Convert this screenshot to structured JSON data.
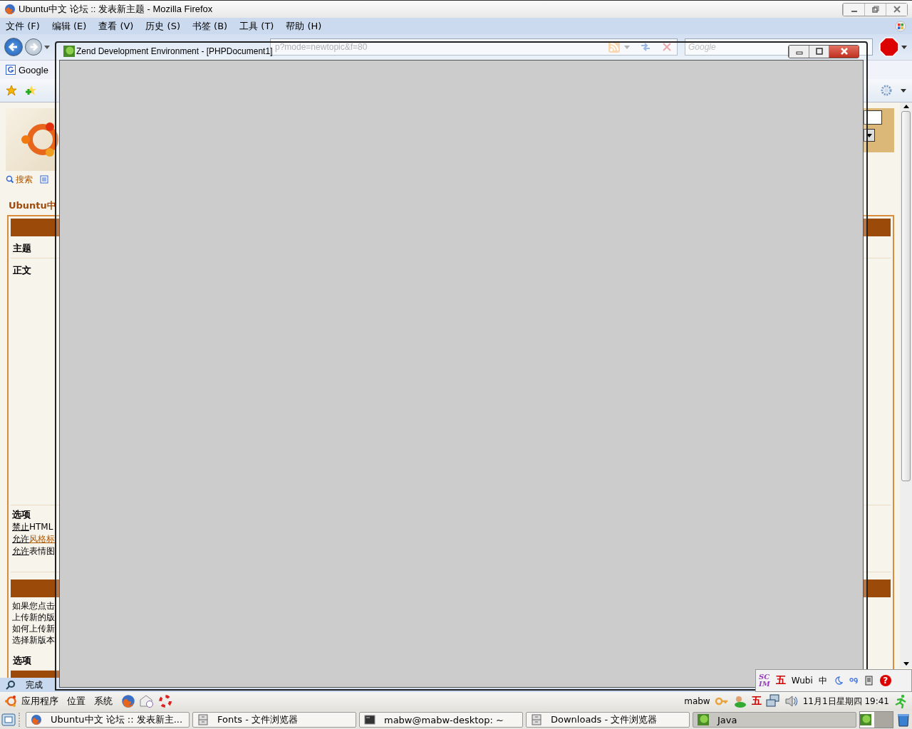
{
  "firefox": {
    "title": "Ubuntu中文 论坛 :: 发表新主题 - Mozilla Firefox",
    "menu": [
      "文件 (F)",
      "编辑 (E)",
      "查看 (V)",
      "历史 (S)",
      "书签 (B)",
      "工具 (T)",
      "帮助 (H)"
    ],
    "address": {
      "value": "p?mode=newtopic&f=80"
    },
    "search": {
      "placeholder": "Google"
    },
    "bookmarks": [
      "Google"
    ],
    "status": "完成"
  },
  "page": {
    "links": [
      "搜索"
    ],
    "heading": "Ubuntu中",
    "rows": [
      {
        "label": "主题",
        "tall": false
      },
      {
        "label": "正文",
        "tall": true
      }
    ],
    "options": {
      "label": "选项",
      "items": [
        {
          "toggle": "禁止",
          "rest": "HTML",
          "rest_link": false
        },
        {
          "toggle": "允许",
          "rest": "风格标",
          "rest_link": true
        },
        {
          "toggle": "允许",
          "rest": "表情图",
          "rest_link": false
        }
      ]
    },
    "info": [
      "如果您点击",
      "上传新的版",
      "如何上传新",
      "选择新版本"
    ],
    "options2": "选项"
  },
  "zend": {
    "title": "Zend Development Environment - [PHPDocument1]"
  },
  "scim": {
    "logo": [
      "SC",
      "IM"
    ],
    "glyph": "五",
    "method": "Wubi",
    "lang": "中",
    "help": "?"
  },
  "panel": {
    "menus": [
      "应用程序",
      "位置",
      "系统"
    ],
    "user": "mabw",
    "glyph": "五",
    "clock": "11月1日星期四 19:41"
  },
  "taskbar": {
    "tasks": [
      {
        "title": "Ubuntu中文 论坛 :: 发表新主...",
        "kind": "browser",
        "selected": false
      },
      {
        "title": "Fonts - 文件浏览器",
        "kind": "files",
        "selected": false
      },
      {
        "title": "mabw@mabw-desktop: ~",
        "kind": "terminal",
        "selected": false
      },
      {
        "title": "Downloads - 文件浏览器",
        "kind": "files",
        "selected": false
      },
      {
        "title": "Java",
        "kind": "java",
        "selected": true
      }
    ]
  }
}
